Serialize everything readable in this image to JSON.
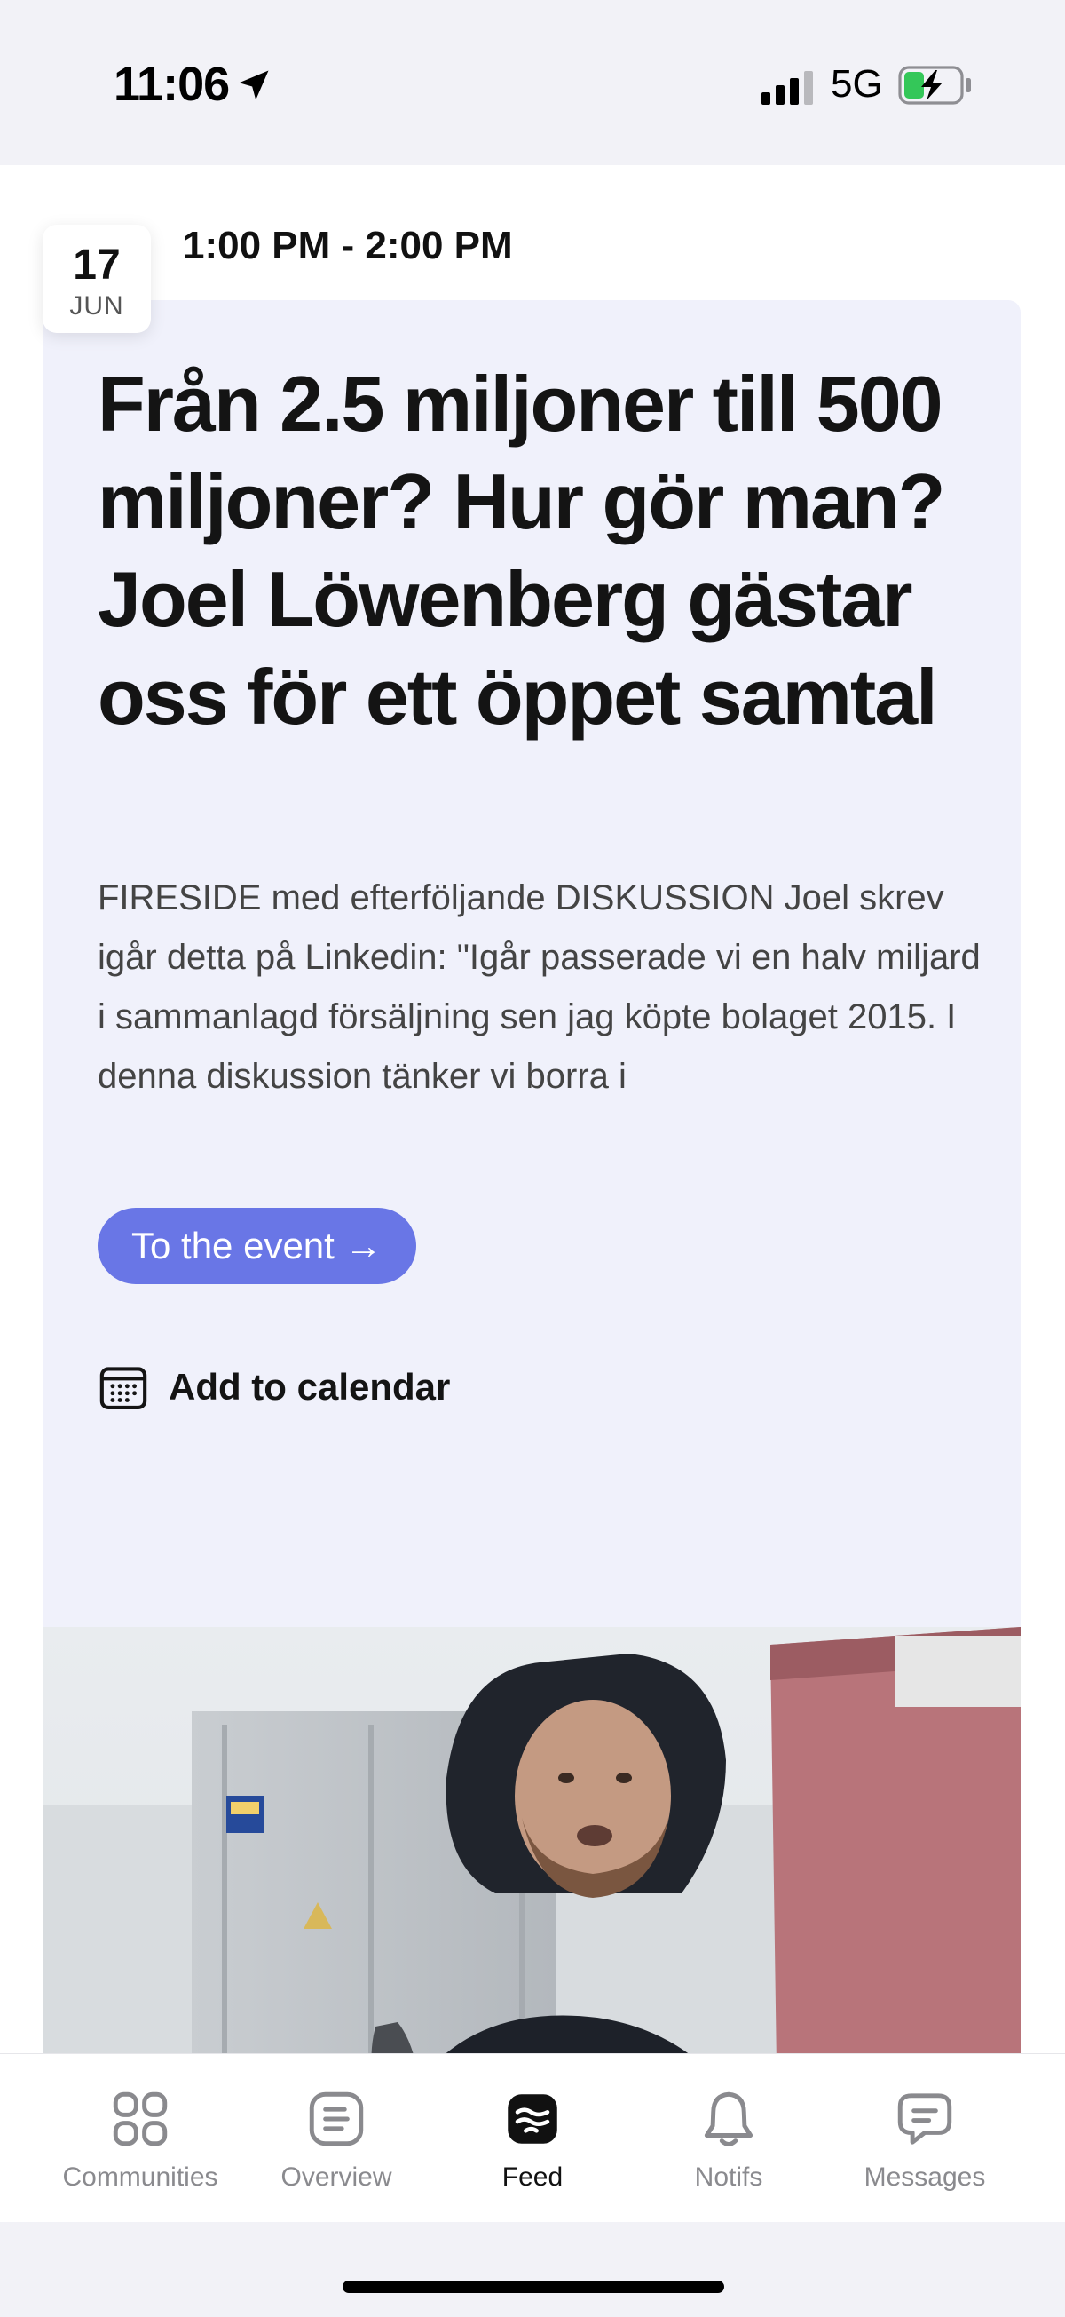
{
  "status_bar": {
    "time": "11:06",
    "network": "5G",
    "icons": [
      "location-arrow-icon",
      "cell-signal-icon",
      "battery-charging-icon"
    ]
  },
  "event": {
    "date_day": "17",
    "date_month": "JUN",
    "time_range": "1:00 PM - 2:00 PM",
    "title": "Från 2.5 miljoner till 500 miljoner? Hur gör man? Joel Löwenberg gästar oss för ett öppet samtal",
    "description": "FIRESIDE med efterföljande DISKUSSION Joel skrev igår detta på Linkedin: \"Igår passerade vi en halv miljard i sammanlagd försäljning sen jag köpte bolaget 2015. I denna diskussion tänker vi borra i",
    "cta_label": "To the event →",
    "calendar_label": "Add to calendar",
    "calendar_icon": "calendar-icon"
  },
  "nav": {
    "tabs": [
      {
        "label": "Communities",
        "icon": "communities-grid-icon"
      },
      {
        "label": "Overview",
        "icon": "overview-list-icon"
      },
      {
        "label": "Feed",
        "icon": "feed-waves-icon"
      },
      {
        "label": "Notifs",
        "icon": "bell-icon"
      },
      {
        "label": "Messages",
        "icon": "chat-bubble-icon"
      }
    ],
    "active": "Feed"
  },
  "colors": {
    "accent": "#6976e6",
    "card_background": "#f0f1fb",
    "page_background": "#f2f2f7"
  }
}
